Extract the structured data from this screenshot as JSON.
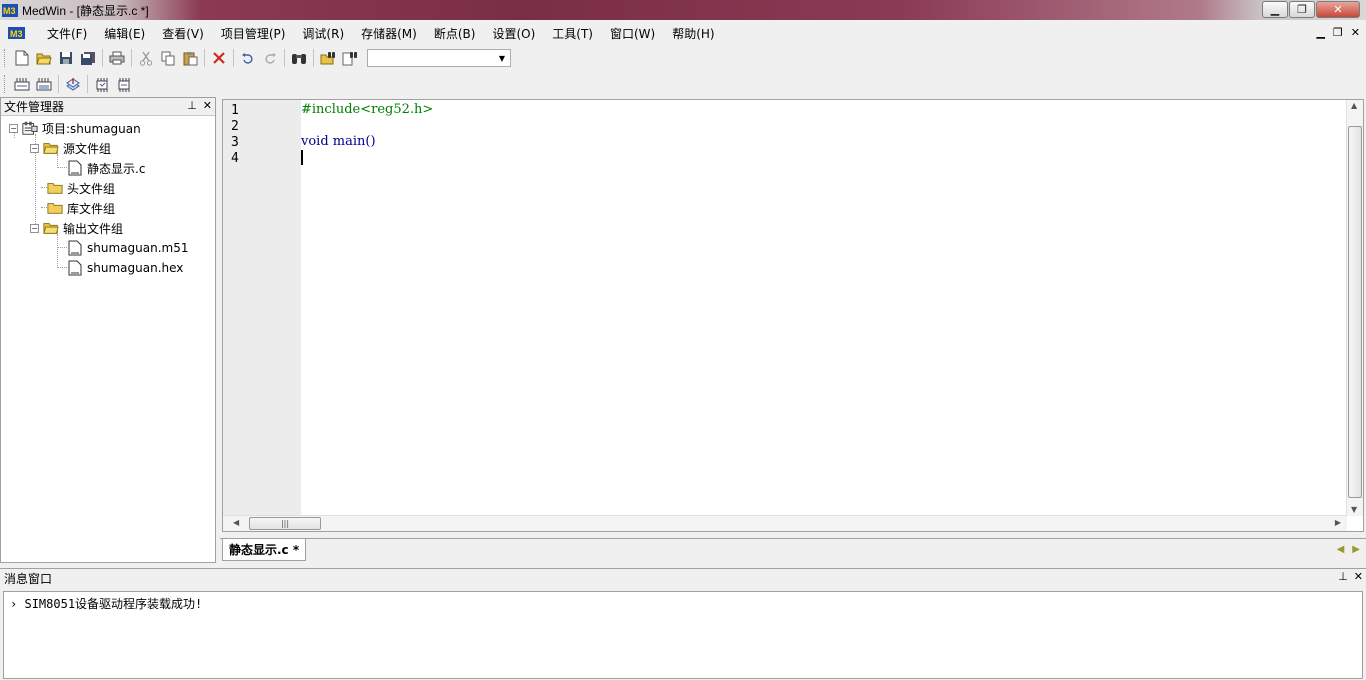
{
  "window": {
    "title": "MedWin - [静态显示.c *]"
  },
  "menu": [
    "文件(F)",
    "编辑(E)",
    "查看(V)",
    "项目管理(P)",
    "调试(R)",
    "存储器(M)",
    "断点(B)",
    "设置(O)",
    "工具(T)",
    "窗口(W)",
    "帮助(H)"
  ],
  "toolbar": {
    "find_combo_value": "",
    "icons": [
      "new-file-icon",
      "open-folder-icon",
      "save-icon",
      "save-all-icon",
      "print-icon",
      "cut-icon",
      "copy-icon",
      "paste-icon",
      "delete-icon",
      "undo-icon",
      "redo-icon",
      "find-icon",
      "find-in-files-icon",
      "replace-icon"
    ]
  },
  "file_manager": {
    "title": "文件管理器",
    "project": "项目:shumaguan",
    "groups": [
      {
        "name": "源文件组",
        "files": [
          "静态显示.c"
        ]
      },
      {
        "name": "头文件组",
        "files": []
      },
      {
        "name": "库文件组",
        "files": []
      },
      {
        "name": "输出文件组",
        "files": [
          "shumaguan.m51",
          "shumaguan.hex"
        ]
      }
    ]
  },
  "editor": {
    "line_numbers": [
      "1",
      "2",
      "3",
      "4"
    ],
    "lines": [
      {
        "text": "#include<reg52.h>",
        "color": "#008000"
      },
      {
        "text": "",
        "color": "#000000"
      },
      {
        "text": "void main()",
        "color": "#00008b"
      },
      {
        "text": "",
        "color": "#000000"
      }
    ],
    "tab_label": "静态显示.c *"
  },
  "messages": {
    "title": "消息窗口",
    "lines": [
      "SIM8051设备驱动程序装载成功!"
    ]
  },
  "colors": {
    "title_bar_accent": "#7a2e45",
    "include_color": "#008000",
    "keyword_color": "#00008b"
  }
}
